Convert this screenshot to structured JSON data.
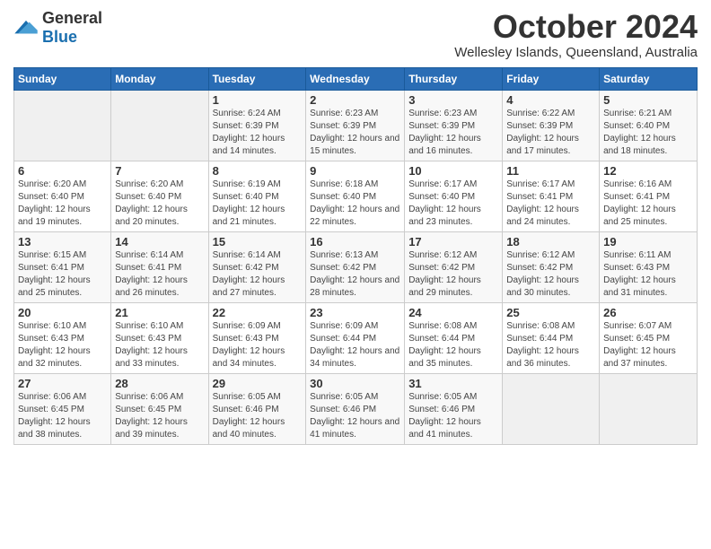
{
  "header": {
    "logo_general": "General",
    "logo_blue": "Blue",
    "main_title": "October 2024",
    "subtitle": "Wellesley Islands, Queensland, Australia"
  },
  "days_of_week": [
    "Sunday",
    "Monday",
    "Tuesday",
    "Wednesday",
    "Thursday",
    "Friday",
    "Saturday"
  ],
  "weeks": [
    [
      {
        "day": "",
        "detail": ""
      },
      {
        "day": "",
        "detail": ""
      },
      {
        "day": "1",
        "detail": "Sunrise: 6:24 AM\nSunset: 6:39 PM\nDaylight: 12 hours and 14 minutes."
      },
      {
        "day": "2",
        "detail": "Sunrise: 6:23 AM\nSunset: 6:39 PM\nDaylight: 12 hours and 15 minutes."
      },
      {
        "day": "3",
        "detail": "Sunrise: 6:23 AM\nSunset: 6:39 PM\nDaylight: 12 hours and 16 minutes."
      },
      {
        "day": "4",
        "detail": "Sunrise: 6:22 AM\nSunset: 6:39 PM\nDaylight: 12 hours and 17 minutes."
      },
      {
        "day": "5",
        "detail": "Sunrise: 6:21 AM\nSunset: 6:40 PM\nDaylight: 12 hours and 18 minutes."
      }
    ],
    [
      {
        "day": "6",
        "detail": "Sunrise: 6:20 AM\nSunset: 6:40 PM\nDaylight: 12 hours and 19 minutes."
      },
      {
        "day": "7",
        "detail": "Sunrise: 6:20 AM\nSunset: 6:40 PM\nDaylight: 12 hours and 20 minutes."
      },
      {
        "day": "8",
        "detail": "Sunrise: 6:19 AM\nSunset: 6:40 PM\nDaylight: 12 hours and 21 minutes."
      },
      {
        "day": "9",
        "detail": "Sunrise: 6:18 AM\nSunset: 6:40 PM\nDaylight: 12 hours and 22 minutes."
      },
      {
        "day": "10",
        "detail": "Sunrise: 6:17 AM\nSunset: 6:40 PM\nDaylight: 12 hours and 23 minutes."
      },
      {
        "day": "11",
        "detail": "Sunrise: 6:17 AM\nSunset: 6:41 PM\nDaylight: 12 hours and 24 minutes."
      },
      {
        "day": "12",
        "detail": "Sunrise: 6:16 AM\nSunset: 6:41 PM\nDaylight: 12 hours and 25 minutes."
      }
    ],
    [
      {
        "day": "13",
        "detail": "Sunrise: 6:15 AM\nSunset: 6:41 PM\nDaylight: 12 hours and 25 minutes."
      },
      {
        "day": "14",
        "detail": "Sunrise: 6:14 AM\nSunset: 6:41 PM\nDaylight: 12 hours and 26 minutes."
      },
      {
        "day": "15",
        "detail": "Sunrise: 6:14 AM\nSunset: 6:42 PM\nDaylight: 12 hours and 27 minutes."
      },
      {
        "day": "16",
        "detail": "Sunrise: 6:13 AM\nSunset: 6:42 PM\nDaylight: 12 hours and 28 minutes."
      },
      {
        "day": "17",
        "detail": "Sunrise: 6:12 AM\nSunset: 6:42 PM\nDaylight: 12 hours and 29 minutes."
      },
      {
        "day": "18",
        "detail": "Sunrise: 6:12 AM\nSunset: 6:42 PM\nDaylight: 12 hours and 30 minutes."
      },
      {
        "day": "19",
        "detail": "Sunrise: 6:11 AM\nSunset: 6:43 PM\nDaylight: 12 hours and 31 minutes."
      }
    ],
    [
      {
        "day": "20",
        "detail": "Sunrise: 6:10 AM\nSunset: 6:43 PM\nDaylight: 12 hours and 32 minutes."
      },
      {
        "day": "21",
        "detail": "Sunrise: 6:10 AM\nSunset: 6:43 PM\nDaylight: 12 hours and 33 minutes."
      },
      {
        "day": "22",
        "detail": "Sunrise: 6:09 AM\nSunset: 6:43 PM\nDaylight: 12 hours and 34 minutes."
      },
      {
        "day": "23",
        "detail": "Sunrise: 6:09 AM\nSunset: 6:44 PM\nDaylight: 12 hours and 34 minutes."
      },
      {
        "day": "24",
        "detail": "Sunrise: 6:08 AM\nSunset: 6:44 PM\nDaylight: 12 hours and 35 minutes."
      },
      {
        "day": "25",
        "detail": "Sunrise: 6:08 AM\nSunset: 6:44 PM\nDaylight: 12 hours and 36 minutes."
      },
      {
        "day": "26",
        "detail": "Sunrise: 6:07 AM\nSunset: 6:45 PM\nDaylight: 12 hours and 37 minutes."
      }
    ],
    [
      {
        "day": "27",
        "detail": "Sunrise: 6:06 AM\nSunset: 6:45 PM\nDaylight: 12 hours and 38 minutes."
      },
      {
        "day": "28",
        "detail": "Sunrise: 6:06 AM\nSunset: 6:45 PM\nDaylight: 12 hours and 39 minutes."
      },
      {
        "day": "29",
        "detail": "Sunrise: 6:05 AM\nSunset: 6:46 PM\nDaylight: 12 hours and 40 minutes."
      },
      {
        "day": "30",
        "detail": "Sunrise: 6:05 AM\nSunset: 6:46 PM\nDaylight: 12 hours and 41 minutes."
      },
      {
        "day": "31",
        "detail": "Sunrise: 6:05 AM\nSunset: 6:46 PM\nDaylight: 12 hours and 41 minutes."
      },
      {
        "day": "",
        "detail": ""
      },
      {
        "day": "",
        "detail": ""
      }
    ]
  ]
}
